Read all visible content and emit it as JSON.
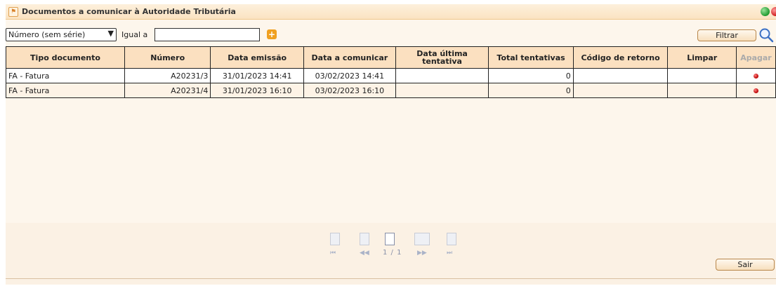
{
  "window": {
    "title": "Documentos a comunicar à Autoridade Tributária",
    "accent": "#fbe0c0"
  },
  "filter": {
    "field_selected": "Número (sem série)",
    "operator_label": "Igual a",
    "value": "",
    "filter_button": "Filtrar"
  },
  "table": {
    "columns": [
      "Tipo documento",
      "Número",
      "Data emissão",
      "Data a comunicar",
      "Data última tentativa",
      "Total tentativas",
      "Código de retorno",
      "Limpar",
      "Apagar"
    ],
    "rows": [
      {
        "tipo": "FA - Fatura",
        "numero": "A20231/3",
        "emissao": "31/01/2023 14:41",
        "comunicar": "03/02/2023 14:41",
        "ultima": "",
        "total": "0",
        "codigo": "",
        "limpar": ""
      },
      {
        "tipo": "FA - Fatura",
        "numero": "A20231/4",
        "emissao": "31/01/2023 16:10",
        "comunicar": "03/02/2023 16:10",
        "ultima": "",
        "total": "0",
        "codigo": "",
        "limpar": ""
      }
    ]
  },
  "pager": {
    "page_label": "1 / 1"
  },
  "footer": {
    "exit_button": "Sair"
  }
}
